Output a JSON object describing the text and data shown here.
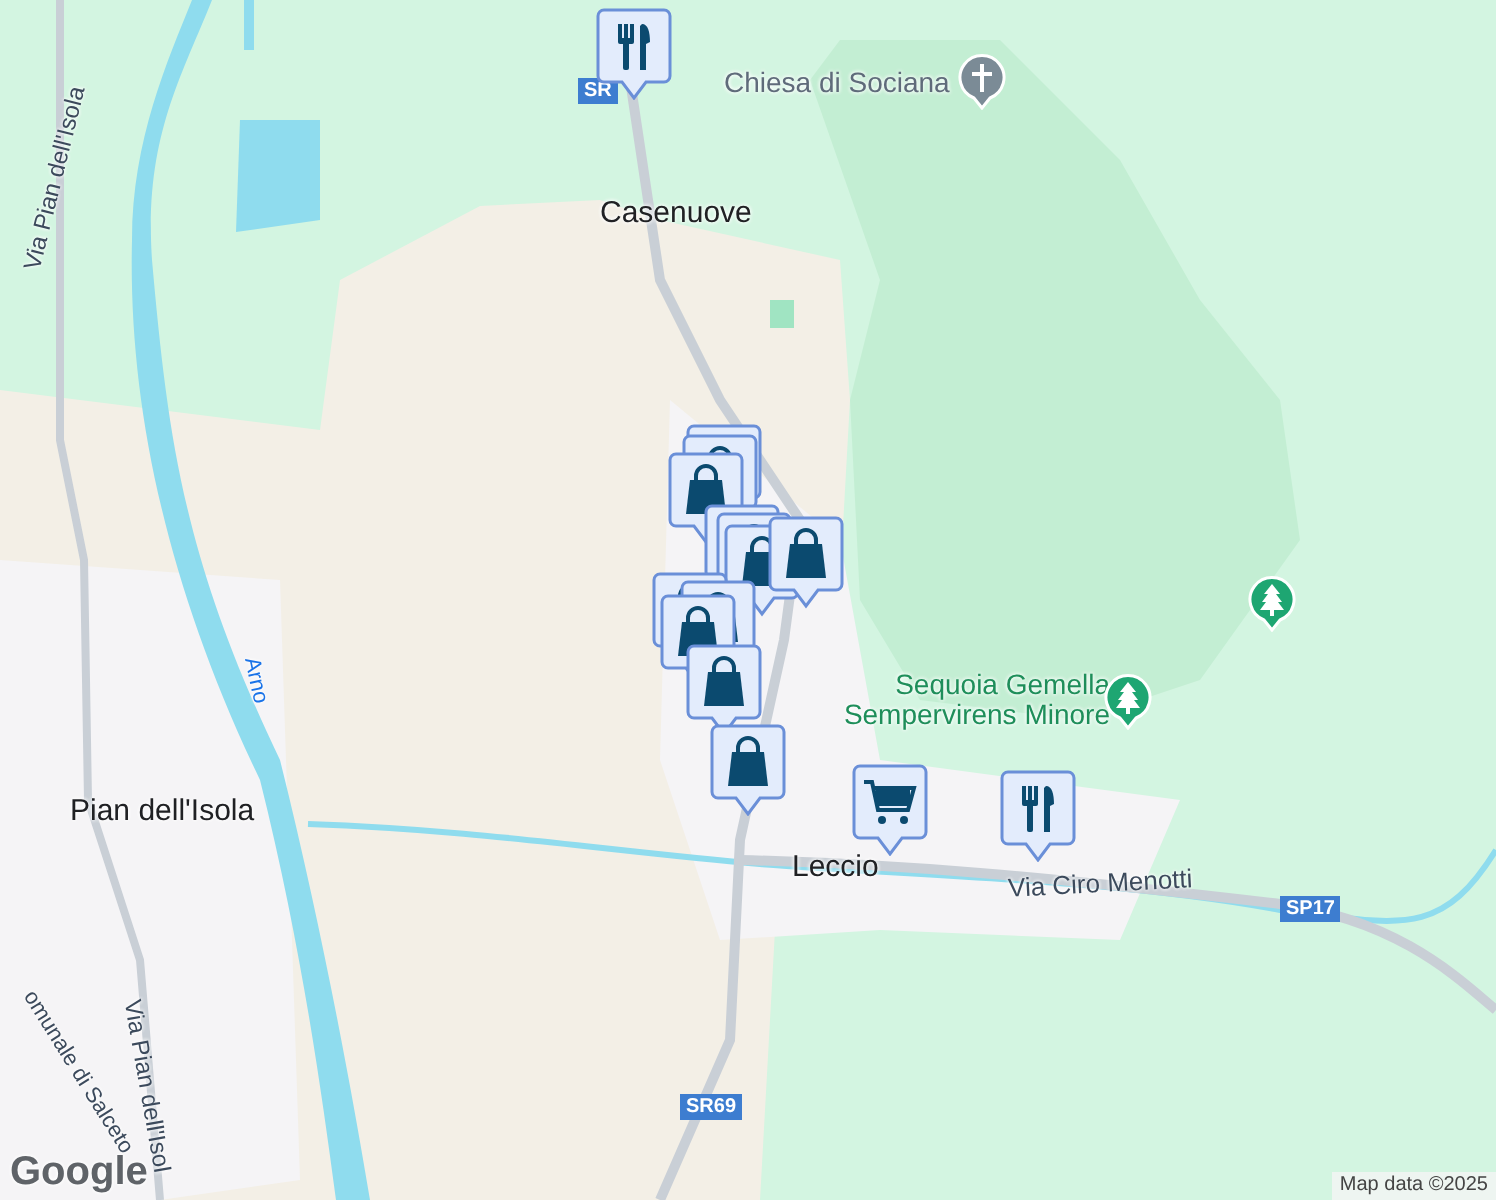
{
  "labels": [
    {
      "kind": "poi",
      "text": "Chiesa di Sociana"
    },
    {
      "kind": "place",
      "text": "Casenuove"
    },
    {
      "kind": "street",
      "text": "Via Pian dell'Isola"
    },
    {
      "kind": "water",
      "text": "Arno"
    },
    {
      "kind": "place",
      "text": "Pian dell'Isola"
    },
    {
      "kind": "park",
      "text": "Sequoia Gemella Sempervirens Minore"
    },
    {
      "kind": "place",
      "text": "Leccio"
    },
    {
      "kind": "street",
      "text": "Via Ciro Menotti"
    },
    {
      "kind": "street",
      "text": "omunale di Salceto"
    },
    {
      "kind": "street",
      "text": "Via Pian dell'Isol"
    },
    {
      "kind": "badge",
      "text": "SR"
    },
    {
      "kind": "badge",
      "text": "SP17"
    },
    {
      "kind": "badge",
      "text": "SR69"
    }
  ],
  "pois": [
    {
      "kind": "church"
    },
    {
      "kind": "tree"
    },
    {
      "kind": "tree"
    }
  ],
  "markers": [
    {
      "kind": "restaurant"
    },
    {
      "kind": "shop_cluster"
    },
    {
      "kind": "grocery"
    },
    {
      "kind": "restaurant"
    }
  ],
  "attribution": {
    "logo": "Google",
    "text": "Map data ©2025"
  }
}
